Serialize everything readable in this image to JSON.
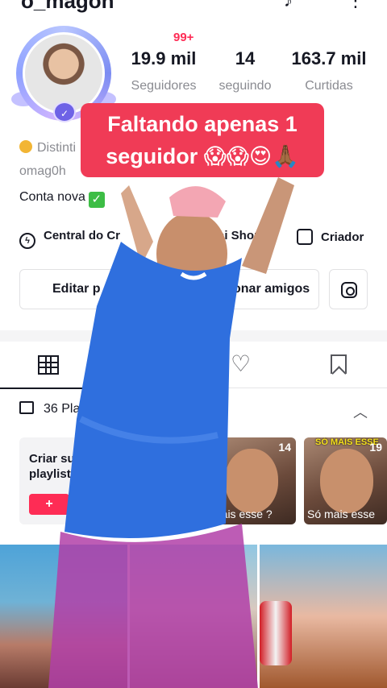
{
  "header": {
    "username": "o_magon",
    "notifications_badge": "99+"
  },
  "stats": [
    {
      "value": "19.9 mil",
      "label": "Seguidores"
    },
    {
      "value": "14",
      "label": "seguindo"
    },
    {
      "value": "163.7 mil",
      "label": "Curtidas"
    }
  ],
  "overlay": {
    "caption": "Faltando apenas 1 seguidor 😱😱😍🙏🏾"
  },
  "bio": {
    "badge": "Distinti",
    "handle": "omag0h",
    "status": "Conta nova",
    "status_emoji": "✅"
  },
  "links": {
    "central": "Central do Cr",
    "shop": "ai Shop",
    "creator": "Criador"
  },
  "buttons": {
    "edit": "Editar p",
    "add_friends": "onar amigos"
  },
  "playlists": {
    "label": "36 Pla",
    "create_card": "Criar su playlist",
    "plus": "+",
    "items": [
      {
        "count": "14",
        "caption": "Mais esse ?"
      },
      {
        "count": "19",
        "caption": "Só mais esse",
        "banner": "SÓ MAIS ESSE"
      }
    ]
  },
  "colors": {
    "accent": "#fe2c55",
    "overlay_bg": "#f03b56",
    "text": "#161823",
    "muted": "#8a8b91"
  }
}
